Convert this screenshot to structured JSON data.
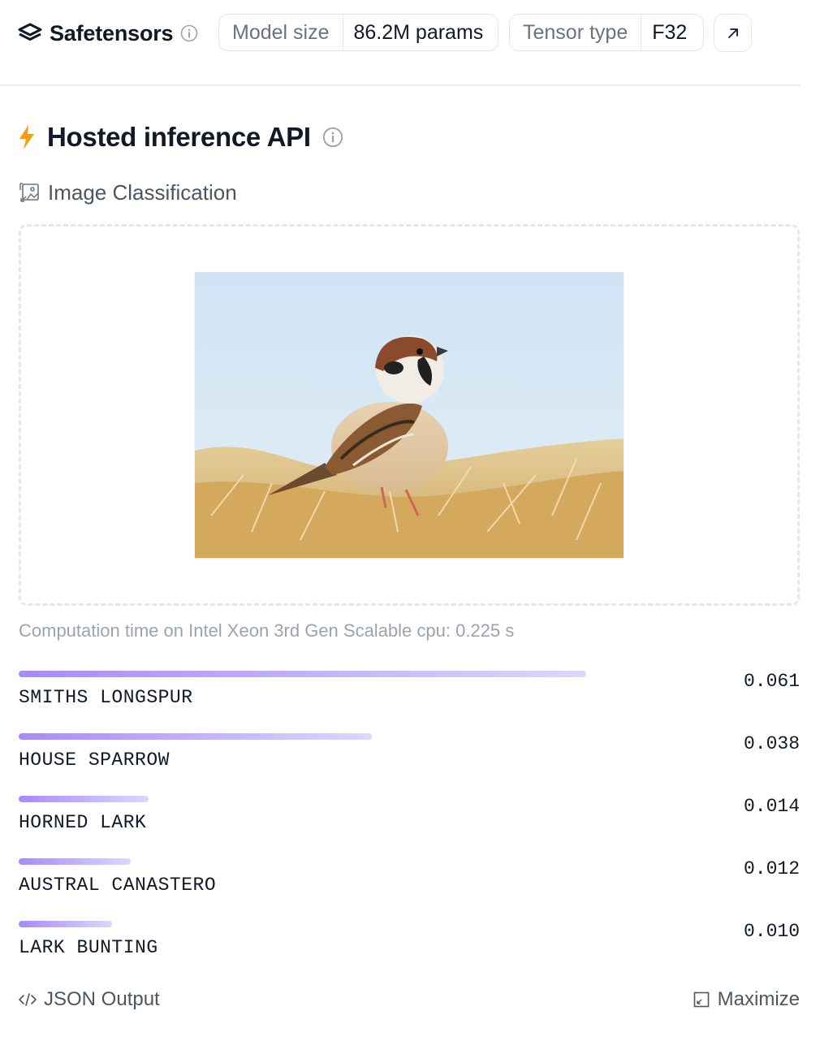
{
  "header": {
    "title": "Safetensors",
    "model_size_label": "Model size",
    "model_size_value": "86.2M params",
    "tensor_type_label": "Tensor type",
    "tensor_type_value": "F32"
  },
  "inference": {
    "heading": "Hosted inference API",
    "task": "Image Classification",
    "image_description": "sparrow",
    "computation": "Computation time on Intel Xeon 3rd Gen Scalable cpu: 0.225 s"
  },
  "results": [
    {
      "label": "SMITHS LONGSPUR",
      "score": "0.061",
      "value": 0.061
    },
    {
      "label": "HOUSE SPARROW",
      "score": "0.038",
      "value": 0.038
    },
    {
      "label": "HORNED LARK",
      "score": "0.014",
      "value": 0.014
    },
    {
      "label": "AUSTRAL CANASTERO",
      "score": "0.012",
      "value": 0.012
    },
    {
      "label": "LARK BUNTING",
      "score": "0.010",
      "value": 0.01
    }
  ],
  "footer": {
    "json_output": "JSON Output",
    "maximize": "Maximize"
  },
  "colors": {
    "accent_bar_start": "#a78bfa",
    "accent_bar_end": "#ddd6fe",
    "lightning": "#f59e0b"
  },
  "icons": [
    "layers-icon",
    "info-icon",
    "external-link-icon",
    "lightning-icon",
    "image-classification-icon",
    "code-icon",
    "maximize-icon"
  ]
}
